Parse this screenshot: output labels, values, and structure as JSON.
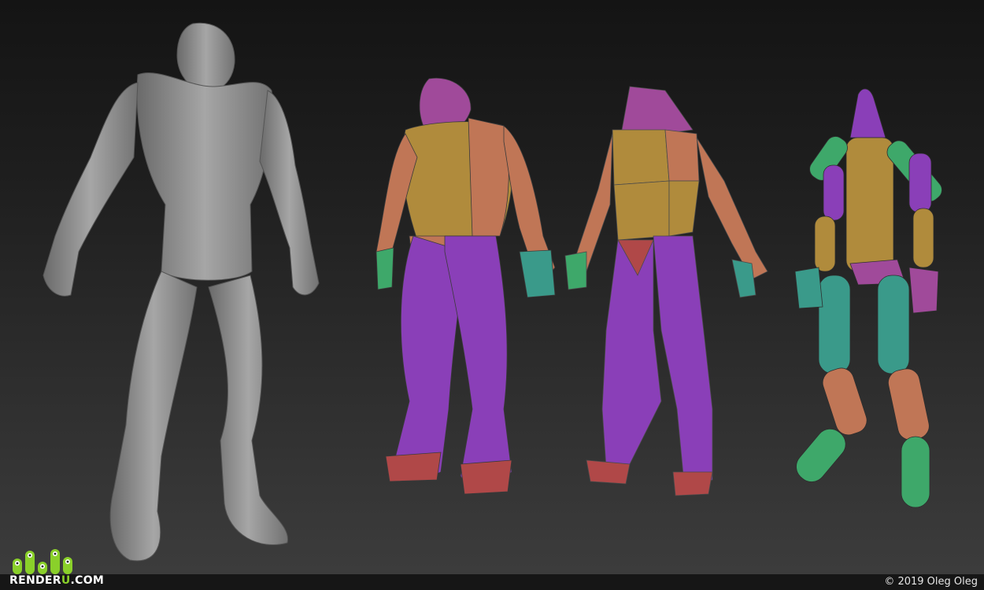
{
  "watermark": {
    "logo_text_main": "RENDER",
    "logo_text_accent": "U",
    "logo_text_suffix": ".COM"
  },
  "copyright": "© 2019 Oleg Oleg",
  "colors": {
    "clay": "#8c8c8c",
    "purple": "#8a3fb8",
    "mustard": "#b08b3c",
    "salmon": "#c07656",
    "magenta": "#a04a9a",
    "green": "#3ea86a",
    "teal": "#3a9a8a",
    "brand_green": "#8ad02a"
  }
}
